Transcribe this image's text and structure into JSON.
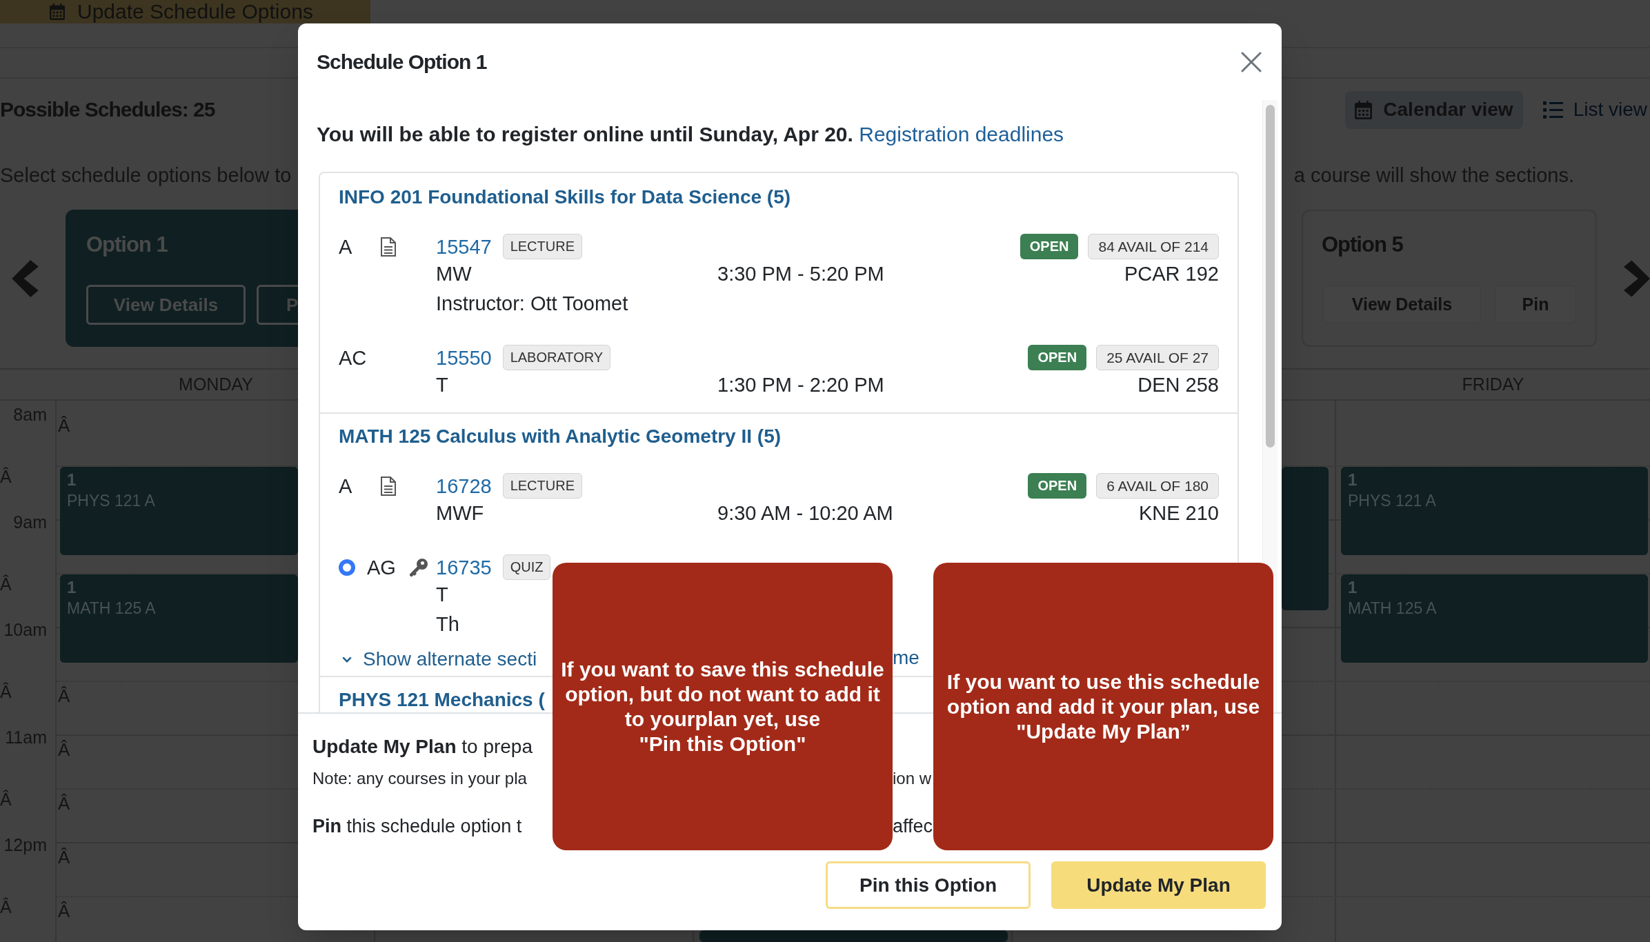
{
  "top_bar": {
    "update_button": "Update Schedule Options"
  },
  "summary": {
    "count": "Possible Schedules: 25",
    "views": [
      {
        "kind": "calendar",
        "label": "Calendar view",
        "selected": true
      },
      {
        "kind": "list",
        "label": "List view",
        "selected": false
      }
    ]
  },
  "intro": [
    "Select schedule options below to",
    "a course will show the sections."
  ],
  "options": [
    {
      "title": "Option 1",
      "selected": true,
      "buttons": [
        "View Details",
        "P"
      ]
    },
    {
      "title": "Option 5",
      "selected": false,
      "buttons": [
        "View Details",
        "Pin"
      ]
    }
  ],
  "calendar": {
    "day_headers": {
      "monday": "MONDAY",
      "friday": "FRIDAY"
    },
    "rows": [
      {
        "kind": "hour",
        "time": "8am",
        "monday_mark": "Â"
      },
      {
        "kind": "half",
        "time": "Â",
        "monday_event": {
          "kind": "short",
          "number": "1",
          "title": "PHYS 121 A"
        },
        "thursday_event": {
          "kind": "long"
        },
        "friday_event": {
          "kind": "short",
          "number": "1",
          "title": "PHYS 121 A"
        }
      },
      {
        "kind": "hour",
        "time": "9am"
      },
      {
        "kind": "half",
        "time": "Â",
        "monday_event": {
          "kind": "short",
          "number": "1",
          "title": "MATH 125 A"
        },
        "friday_event": {
          "kind": "short",
          "number": "1",
          "title": "MATH 125 A"
        }
      },
      {
        "kind": "hour",
        "time": "10am"
      },
      {
        "kind": "half",
        "time": "Â",
        "monday_mark": "Â"
      },
      {
        "kind": "hour",
        "time": "11am",
        "monday_mark": "Â"
      },
      {
        "kind": "half",
        "time": "Â",
        "monday_mark": "Â"
      },
      {
        "kind": "hour",
        "time": "12pm",
        "monday_mark": "Â"
      },
      {
        "kind": "half",
        "time": "Â",
        "monday_mark": "Â",
        "wednesday_event": {
          "kind": "tail"
        }
      }
    ]
  },
  "modal": {
    "title": "Schedule Option 1",
    "notice": "You will be able to register online until Sunday, Apr 20.",
    "notice_link": "Registration deadlines",
    "courses": [
      {
        "title": "INFO 201 Foundational Skills for Data Science (5)",
        "sections": [
          {
            "kind": "lecture",
            "letter": "A",
            "number": "15547",
            "type": "LECTURE",
            "status": "OPEN",
            "availability": "84 AVAIL OF 214",
            "meetings": [
              {
                "days": "MW",
                "time": "3:30 PM - 5:20 PM",
                "room": "PCAR 192"
              }
            ],
            "instructor": "Instructor: Ott Toomet"
          },
          {
            "kind": "lab",
            "letter": "AC",
            "number": "15550",
            "type": "LABORATORY",
            "status": "OPEN",
            "availability": "25 AVAIL OF 27",
            "meetings": [
              {
                "days": "T",
                "time": "1:30 PM - 2:20 PM",
                "room": "DEN 258"
              }
            ]
          }
        ]
      },
      {
        "title": "MATH 125 Calculus with Analytic Geometry II (5)",
        "sections": [
          {
            "kind": "lecture",
            "letter": "A",
            "number": "16728",
            "type": "LECTURE",
            "status": "OPEN",
            "availability": "6 AVAIL OF 180",
            "meetings": [
              {
                "days": "MWF",
                "time": "9:30 AM - 10:20 AM",
                "room": "KNE 210"
              }
            ]
          },
          {
            "kind": "quiz",
            "letter": "AG",
            "radio": {
              "selected": true
            },
            "number": "16735",
            "type": "QUIZ",
            "meetings": [
              {
                "days": "T"
              },
              {
                "days": "Th"
              }
            ]
          }
        ],
        "show_alternate": [
          "Show alternate secti",
          "me"
        ]
      },
      {
        "title": "PHYS 121 Mechanics ("
      }
    ],
    "footer": {
      "update_hint": "**Update My Plan** to prepa",
      "note": [
        "Note: any courses in your pla",
        "ion w"
      ],
      "pin_hint": [
        "**Pin** this schedule option t",
        "affec"
      ],
      "buttons": [
        {
          "kind": "outline",
          "label": "Pin this Option"
        },
        {
          "kind": "primary",
          "label": "Update My Plan"
        }
      ]
    }
  },
  "annotations": [
    {
      "text": "If you want to save this schedule\noption, but do not want to add it\nto yourplan yet, use\n\"Pin this Option\""
    },
    {
      "text": "If you want to use this schedule\noption and add it your plan, use\n\"Update My Plan”"
    }
  ]
}
